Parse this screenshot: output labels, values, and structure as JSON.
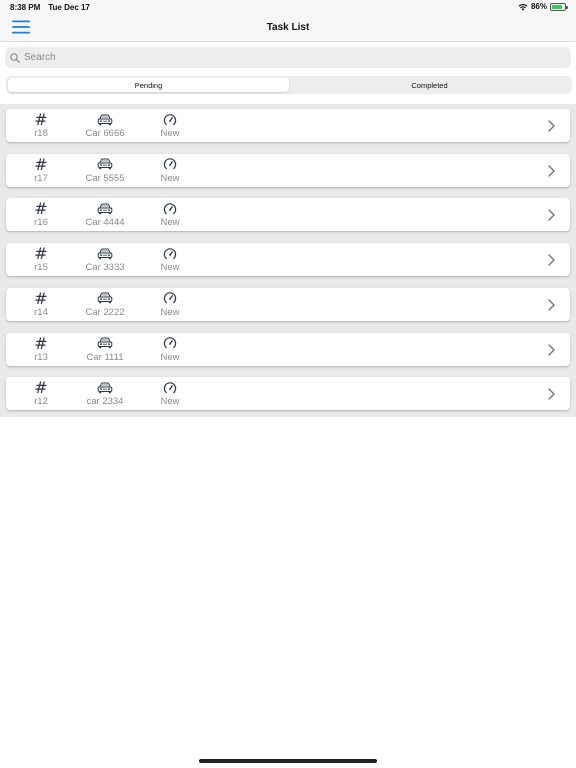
{
  "status_bar": {
    "time": "8:38 PM",
    "date": "Tue Dec 17",
    "battery": "86%",
    "battery_level": 0.86
  },
  "nav": {
    "title": "Task List"
  },
  "search": {
    "placeholder": "Search"
  },
  "segments": [
    {
      "label": "Pending",
      "active": true
    },
    {
      "label": "Completed",
      "active": false
    }
  ],
  "tasks": [
    {
      "id": "r18",
      "car": "Car 6666",
      "status": "New"
    },
    {
      "id": "r17",
      "car": "Car 5555",
      "status": "New"
    },
    {
      "id": "r16",
      "car": "Car 4444",
      "status": "New"
    },
    {
      "id": "r15",
      "car": "Car 3333",
      "status": "New"
    },
    {
      "id": "r14",
      "car": "Car 2222",
      "status": "New"
    },
    {
      "id": "r13",
      "car": "Car 1111",
      "status": "New"
    },
    {
      "id": "r12",
      "car": "car 2334",
      "status": "New"
    }
  ],
  "colors": {
    "accent": "#1a7de6",
    "icon": "#2c3447",
    "muted_text": "#8a8a8e",
    "battery": "#34c759"
  }
}
